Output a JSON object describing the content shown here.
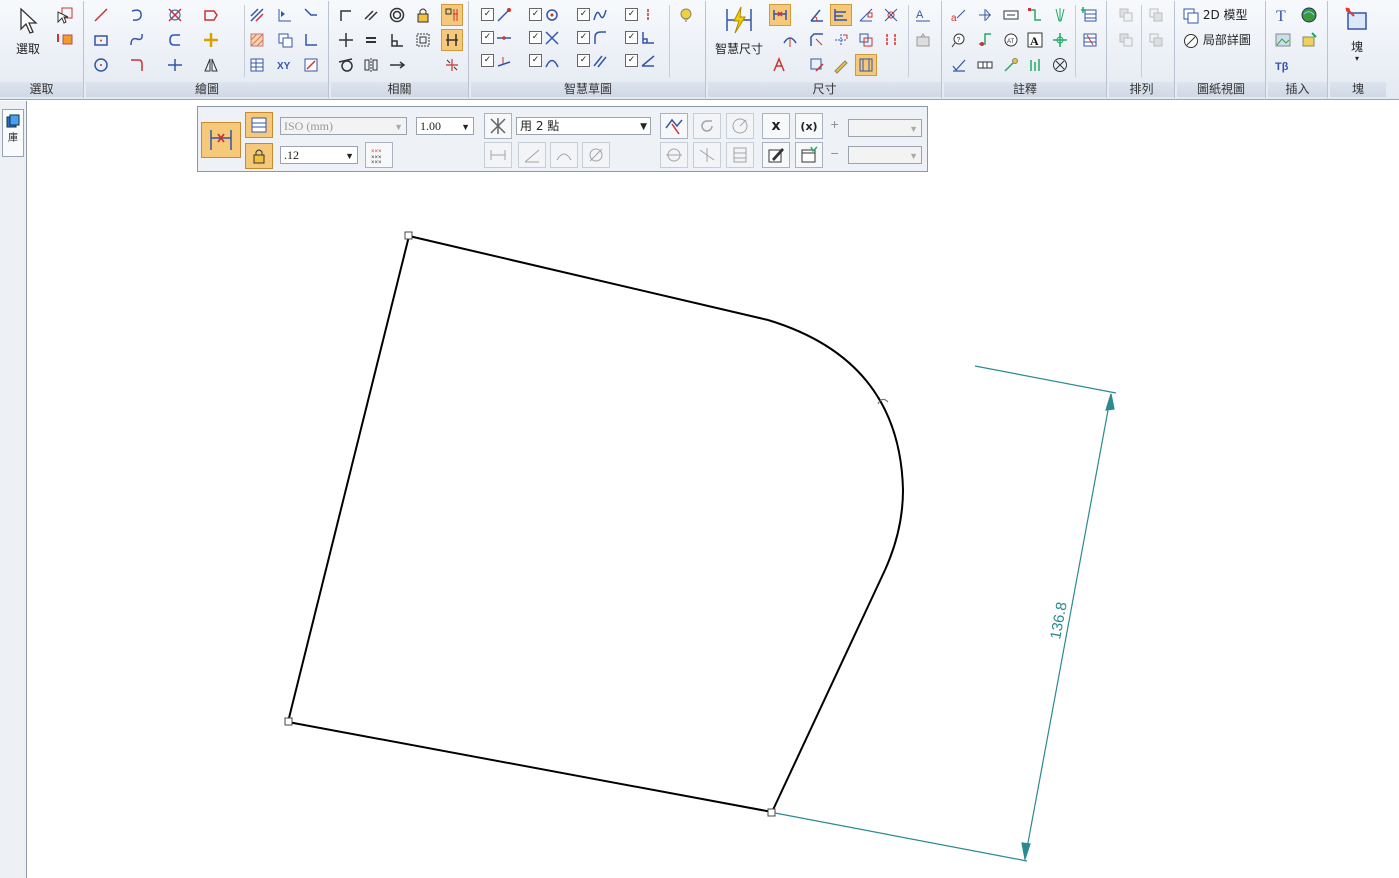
{
  "ribbon": {
    "groups": {
      "select": "選取",
      "draw": "繪圖",
      "relate": "相關",
      "intellisketch": "智慧草圖",
      "dimension": "尺寸",
      "annotation": "註釋",
      "arrange": "排列",
      "drawing_views": "圖紙視圖",
      "insert": "插入",
      "block": "塊"
    },
    "buttons": {
      "select": "選取",
      "smart_dimension": "智慧尺寸",
      "model_2d": "2D 模型",
      "detail_view": "局部詳圖",
      "block": "塊"
    }
  },
  "left_panel": {
    "tab_label": "庫"
  },
  "command_bar": {
    "style_value": "ISO (mm)",
    "scale_value": "1.00",
    "precision_value": ".12",
    "mode_value": "用 2 點",
    "cancel_x": "x",
    "cancel_circled": "(x)",
    "plus_sign": "+",
    "minus_sign": "−",
    "plus_tolerance": "",
    "minus_tolerance": ""
  },
  "drawing": {
    "dimension_value": "136.8",
    "colors": {
      "geometry": "#000000",
      "dimension": "#2a8a8f"
    }
  }
}
